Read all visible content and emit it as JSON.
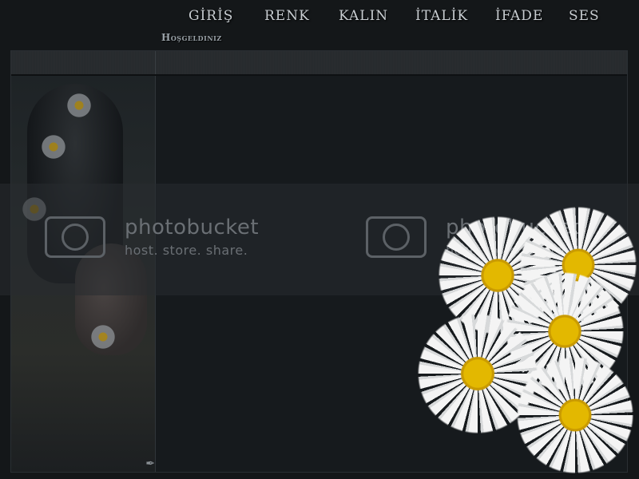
{
  "nav": {
    "items": [
      {
        "label": "GİRİŞ"
      },
      {
        "label": "RENK"
      },
      {
        "label": "KALIN"
      },
      {
        "label": "İTALİK"
      },
      {
        "label": "İFADE"
      },
      {
        "label": "SES"
      }
    ]
  },
  "welcome": {
    "text": "Hoşgeldiniz"
  },
  "watermark": {
    "brand": "photobucket",
    "tagline": "host. store. share."
  },
  "icons": {
    "camera": "camera-icon",
    "corner": "feather-icon",
    "daisy": "daisy-flower-icon"
  },
  "colors": {
    "background": "#141719",
    "nav_text": "#c9ced2",
    "header_bar": "#2a2d30"
  }
}
